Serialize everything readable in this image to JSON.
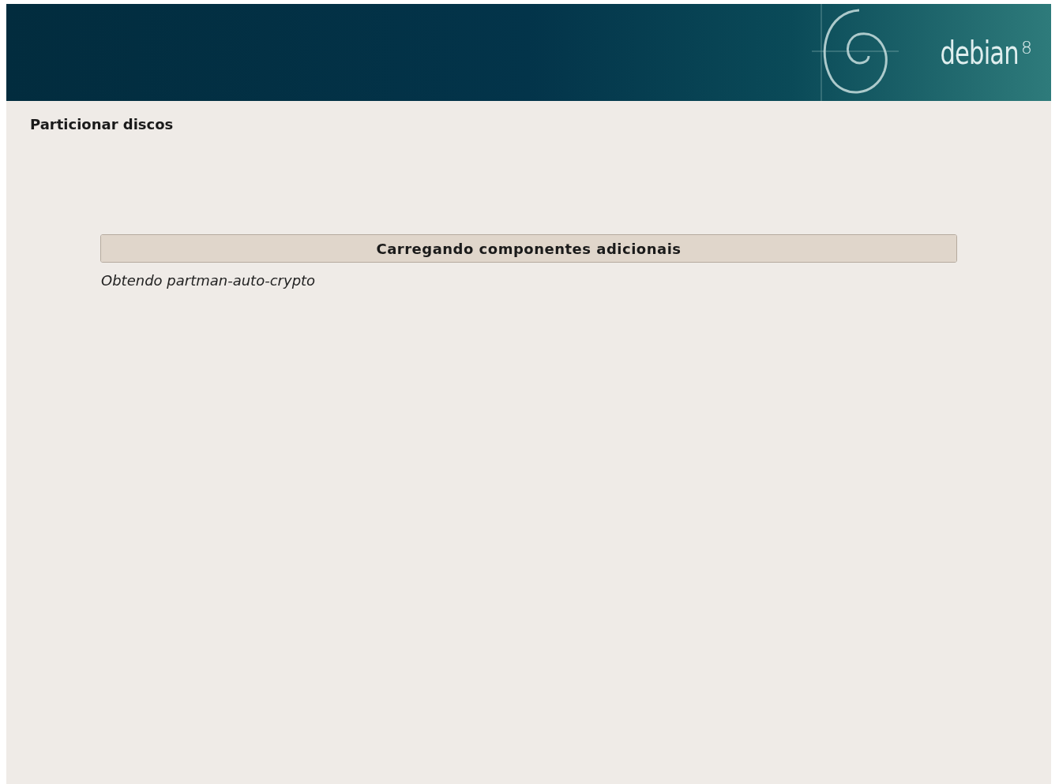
{
  "header": {
    "logo_text": "debian",
    "logo_version": "8"
  },
  "title": "Particionar discos",
  "progress": {
    "label": "Carregando componentes adicionais",
    "level": 1,
    "status": "Obtendo partman-auto-crypto"
  }
}
